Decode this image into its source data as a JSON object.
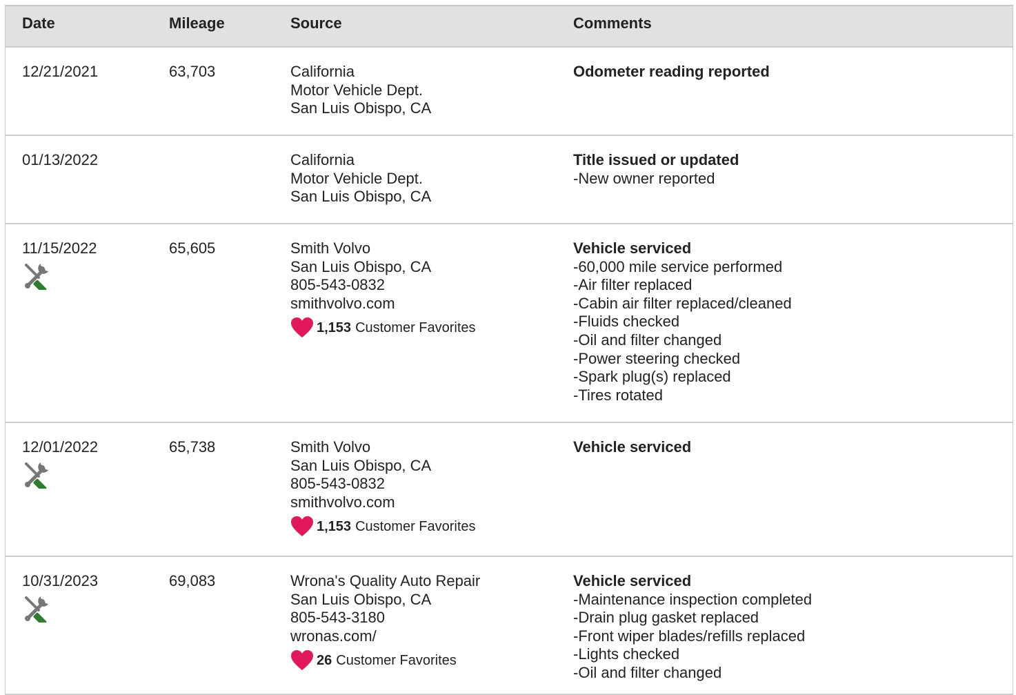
{
  "headers": {
    "date": "Date",
    "mileage": "Mileage",
    "source": "Source",
    "comments": "Comments"
  },
  "colors": {
    "header_bg": "#e1e1e1",
    "heart": "#e0195a",
    "wrench_handle": "#2e7d32",
    "tool_gray": "#777777"
  },
  "rows": [
    {
      "date": "12/21/2021",
      "mileage": "63,703",
      "source": [
        "California",
        "Motor Vehicle Dept.",
        "San Luis Obispo, CA"
      ],
      "comment_title": "Odometer reading reported",
      "comment_items": []
    },
    {
      "date": "01/13/2022",
      "mileage": "",
      "source": [
        "California",
        "Motor Vehicle Dept.",
        "San Luis Obispo, CA"
      ],
      "comment_title": "Title issued or updated",
      "comment_items": [
        "New owner reported"
      ]
    },
    {
      "date": "11/15/2022",
      "mileage": "65,605",
      "service_icon": "service-tools-icon",
      "source": [
        "Smith Volvo",
        "San Luis Obispo, CA",
        "805-543-0832",
        "smithvolvo.com"
      ],
      "favorites_count": "1,153",
      "favorites_label": "Customer Favorites",
      "comment_title": "Vehicle serviced",
      "comment_items": [
        "60,000 mile service performed",
        "Air filter replaced",
        "Cabin air filter replaced/cleaned",
        "Fluids checked",
        "Oil and filter changed",
        "Power steering checked",
        "Spark plug(s) replaced",
        "Tires rotated"
      ]
    },
    {
      "date": "12/01/2022",
      "mileage": "65,738",
      "service_icon": "service-tools-icon",
      "source": [
        "Smith Volvo",
        "San Luis Obispo, CA",
        "805-543-0832",
        "smithvolvo.com"
      ],
      "favorites_count": "1,153",
      "favorites_label": "Customer Favorites",
      "comment_title": "Vehicle serviced",
      "comment_items": []
    },
    {
      "date": "10/31/2023",
      "mileage": "69,083",
      "service_icon": "service-tools-icon",
      "source": [
        "Wrona's Quality Auto Repair",
        "San Luis Obispo, CA",
        "805-543-3180",
        "wronas.com/"
      ],
      "favorites_count": "26",
      "favorites_label": "Customer Favorites",
      "comment_title": "Vehicle serviced",
      "comment_items": [
        "Maintenance inspection completed",
        "Drain plug gasket replaced",
        "Front wiper blades/refills replaced",
        "Lights checked",
        "Oil and filter changed"
      ]
    }
  ]
}
